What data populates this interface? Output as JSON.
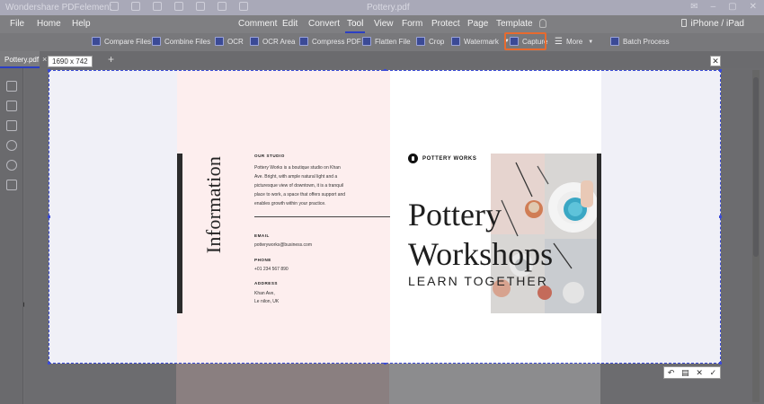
{
  "titlebar": {
    "app": "Wondershare PDFelement",
    "doc": "Pottery.pdf"
  },
  "menubar": {
    "items": [
      "File",
      "Home",
      "Help",
      "Comment",
      "Edit",
      "Convert",
      "Tool",
      "View",
      "Form",
      "Protect",
      "Page",
      "Template"
    ],
    "active": "Tool",
    "device": "iPhone / iPad"
  },
  "toolbar": {
    "tools": [
      "Compare Files",
      "Combine Files",
      "OCR",
      "OCR Area",
      "Compress PDF",
      "Flatten File",
      "Crop",
      "Watermark",
      "Capture",
      "More",
      "Batch Process"
    ],
    "highlighted": "Capture"
  },
  "tabs": {
    "file": "Pottery.pdf",
    "close": "×",
    "add": "+"
  },
  "capture": {
    "size_label": "1690 x 742",
    "close": "✕"
  },
  "brochure": {
    "vertical_title": "Information",
    "studio_heading": "OUR STUDIO",
    "studio_lines": [
      "Pottery Works is a boutique studio on Khan",
      "Ave. Bright, with ample natural light and a",
      "picturesque view of downtown, it is a tranquil",
      "place to work, a space that offers support and",
      "enables growth within your practice."
    ],
    "email_heading": "EMAIL",
    "email": "potteryworks@business.com",
    "phone_heading": "PHONE",
    "phone": "+01 234 567 890",
    "address_heading": "ADDRESS",
    "address_lines": [
      "Khan Ave,",
      "Le nilon, UK"
    ],
    "brand": "POTTERY WORKS",
    "headline_1": "Pottery",
    "headline_2": "Workshops",
    "tagline": "LEARN TOGETHER"
  },
  "colors": {
    "accent": "#2b3fc4",
    "capture_highlight": "#e86a2e",
    "selection": "#3b4bd6",
    "brochure_pink": "#fdeeee"
  }
}
